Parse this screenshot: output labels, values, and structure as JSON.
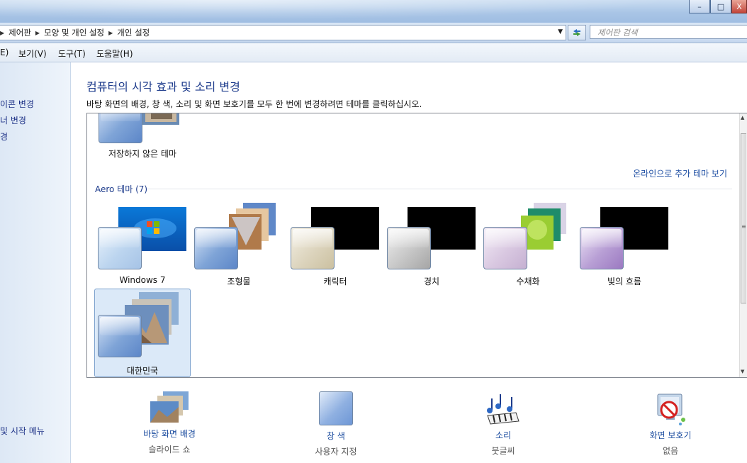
{
  "window": {
    "buttons": [
      "–",
      "□",
      "X"
    ]
  },
  "address": {
    "breadcrumb": [
      "제어판",
      "모양 및 개인 설정",
      "개인 설정"
    ],
    "search_placeholder": "제어판 검색"
  },
  "menu": {
    "items": [
      "E)",
      "보기(V)",
      "도구(T)",
      "도움말(H)"
    ]
  },
  "sidebar": {
    "items": [
      "이콘 변경",
      "너 변경",
      "경",
      "및 시작 메뉴"
    ]
  },
  "main": {
    "title": "컴퓨터의 시각 효과 및 소리 변경",
    "subtitle": "바탕 화면의 배경, 창 색, 소리 및 화면 보호기를 모두 한 번에 변경하려면 테마를 클릭하십시오."
  },
  "themes": {
    "unsaved_label": "저장하지 않은 테마",
    "online_link": "온라인으로 추가 테마 보기",
    "aero_section": "Aero 테마 (7)",
    "items": [
      {
        "name": "Windows 7",
        "selected": false
      },
      {
        "name": "조형물",
        "selected": false
      },
      {
        "name": "캐릭터",
        "selected": false
      },
      {
        "name": "경치",
        "selected": false
      },
      {
        "name": "수채화",
        "selected": false
      },
      {
        "name": "빛의 흐름",
        "selected": false
      },
      {
        "name": "대한민국",
        "selected": true
      }
    ]
  },
  "bottom": {
    "items": [
      {
        "label": "바탕 화면 배경",
        "sub": "슬라이드 쇼",
        "icon": "desktop-background-icon"
      },
      {
        "label": "창 색",
        "sub": "사용자 지정",
        "icon": "window-color-icon"
      },
      {
        "label": "소리",
        "sub": "붓글씨",
        "icon": "sounds-icon"
      },
      {
        "label": "화면 보호기",
        "sub": "없음",
        "icon": "screensaver-icon"
      }
    ]
  },
  "colors": {
    "accent": "#1e3c8c",
    "link": "#1f4fa3",
    "selection": "#dbe9f8"
  }
}
